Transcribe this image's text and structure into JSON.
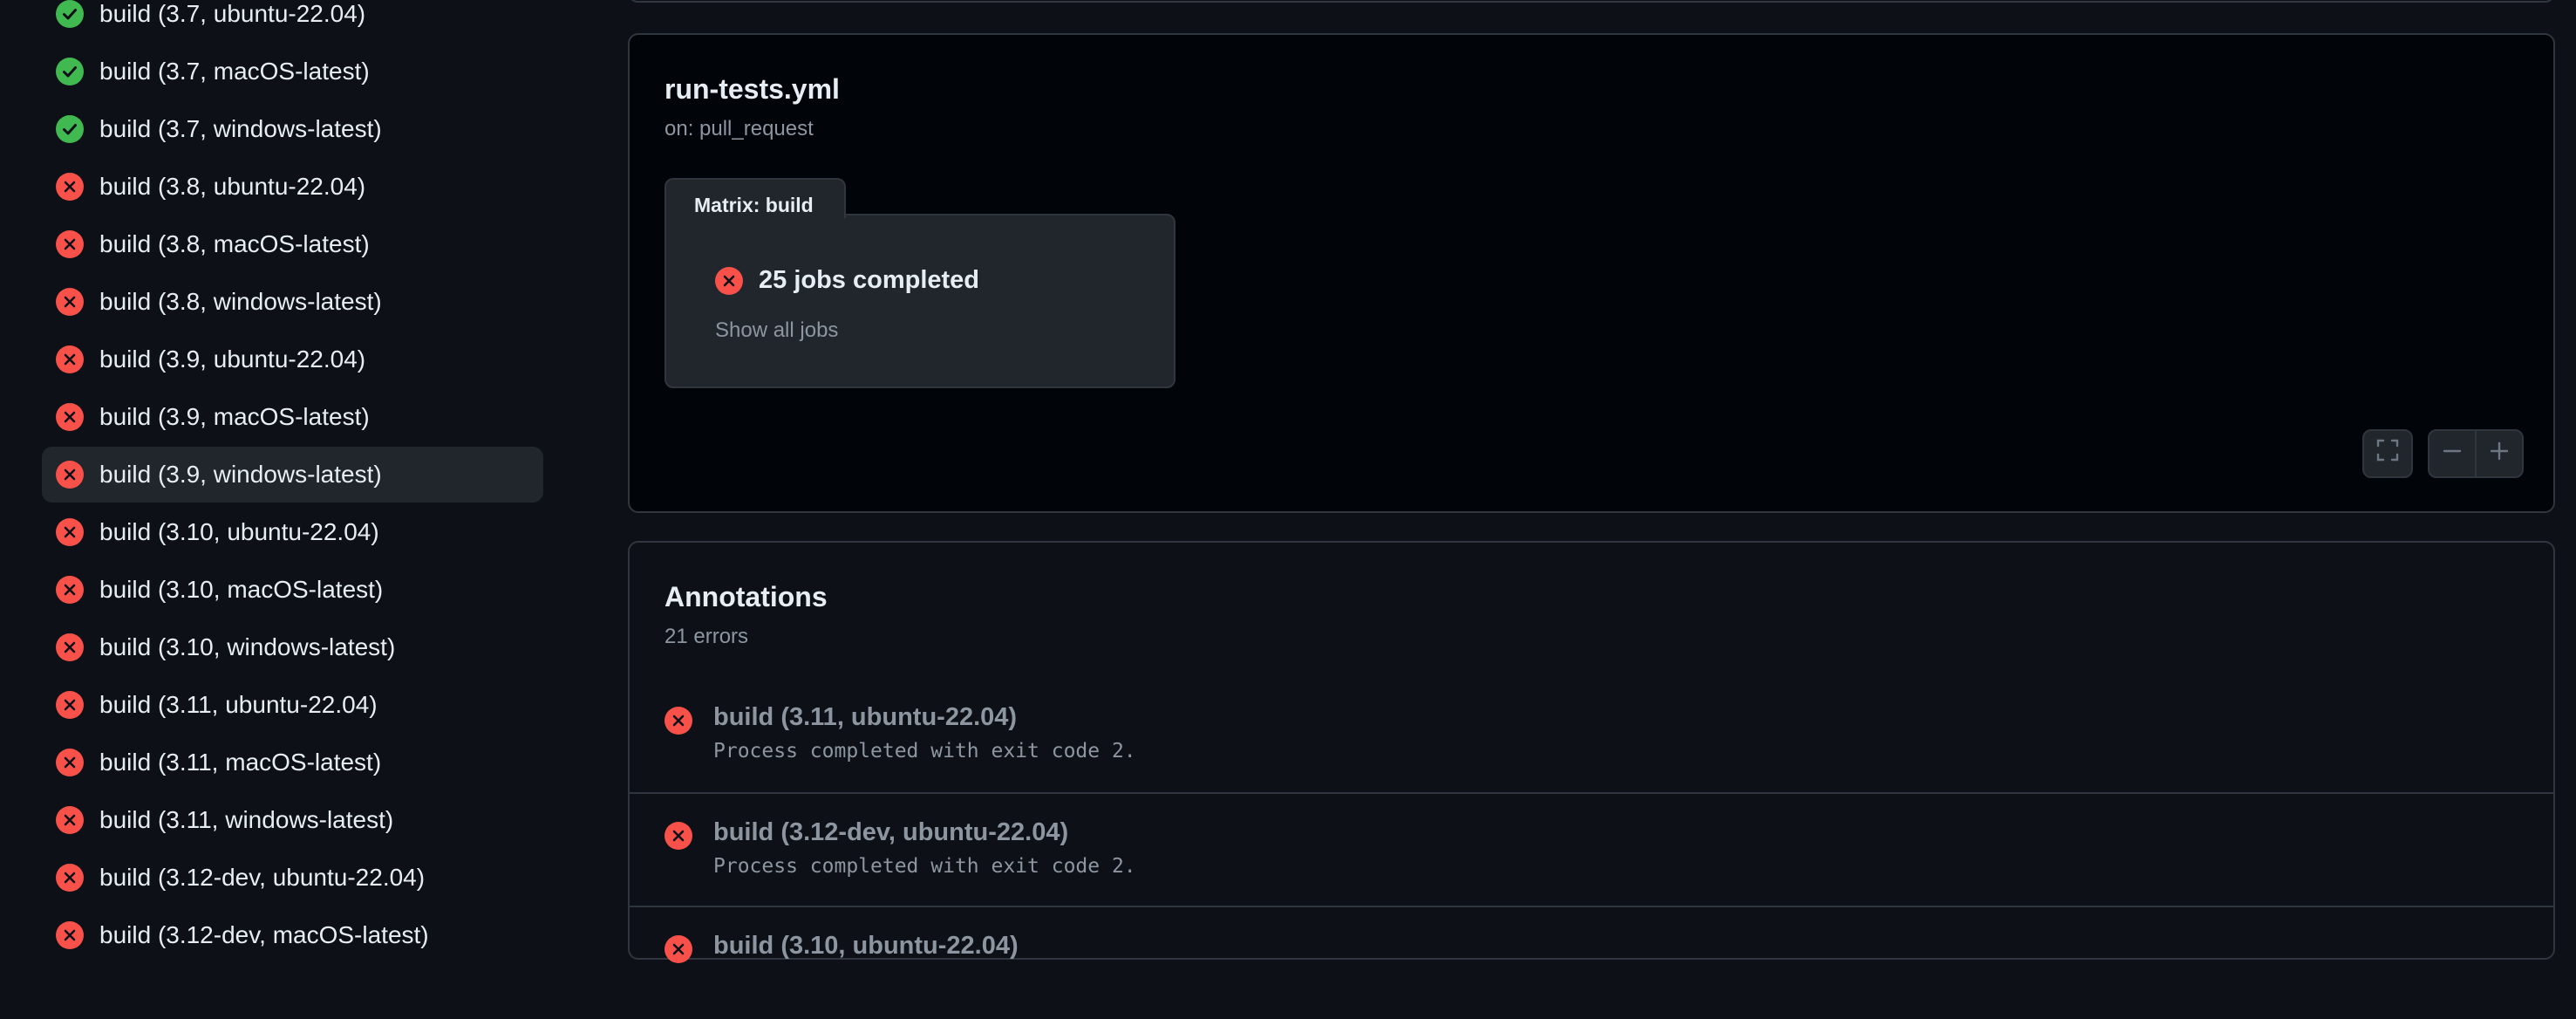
{
  "colors": {
    "success": "#3fb950",
    "failure": "#f85149",
    "background": "#0d1117",
    "panel": "#010409",
    "border": "#30363d"
  },
  "sidebar": {
    "jobs": [
      {
        "label": "build (3.7, ubuntu-22.04)",
        "status": "success"
      },
      {
        "label": "build (3.7, macOS-latest)",
        "status": "success"
      },
      {
        "label": "build (3.7, windows-latest)",
        "status": "success"
      },
      {
        "label": "build (3.8, ubuntu-22.04)",
        "status": "failure"
      },
      {
        "label": "build (3.8, macOS-latest)",
        "status": "failure"
      },
      {
        "label": "build (3.8, windows-latest)",
        "status": "failure"
      },
      {
        "label": "build (3.9, ubuntu-22.04)",
        "status": "failure"
      },
      {
        "label": "build (3.9, macOS-latest)",
        "status": "failure"
      },
      {
        "label": "build (3.9, windows-latest)",
        "status": "failure",
        "selected": true
      },
      {
        "label": "build (3.10, ubuntu-22.04)",
        "status": "failure"
      },
      {
        "label": "build (3.10, macOS-latest)",
        "status": "failure"
      },
      {
        "label": "build (3.10, windows-latest)",
        "status": "failure"
      },
      {
        "label": "build (3.11, ubuntu-22.04)",
        "status": "failure"
      },
      {
        "label": "build (3.11, macOS-latest)",
        "status": "failure"
      },
      {
        "label": "build (3.11, windows-latest)",
        "status": "failure"
      },
      {
        "label": "build (3.12-dev, ubuntu-22.04)",
        "status": "failure"
      },
      {
        "label": "build (3.12-dev, macOS-latest)",
        "status": "failure"
      }
    ]
  },
  "workflow_graph": {
    "file_name": "run-tests.yml",
    "trigger": "on: pull_request",
    "matrix_label": "Matrix: build",
    "matrix_status": "25 jobs completed",
    "show_all_label": "Show all jobs",
    "controls": {
      "fullscreen_icon": "fullscreen-icon",
      "zoom_out_icon": "minus-icon",
      "zoom_in_icon": "plus-icon"
    }
  },
  "annotations": {
    "title": "Annotations",
    "summary": "21 errors",
    "items": [
      {
        "job": "build (3.11, ubuntu-22.04)",
        "message": "Process completed with exit code 2.",
        "status": "failure"
      },
      {
        "job": "build (3.12-dev, ubuntu-22.04)",
        "message": "Process completed with exit code 2.",
        "status": "failure"
      },
      {
        "job": "build (3.10, ubuntu-22.04)",
        "message": "",
        "status": "failure"
      }
    ]
  }
}
